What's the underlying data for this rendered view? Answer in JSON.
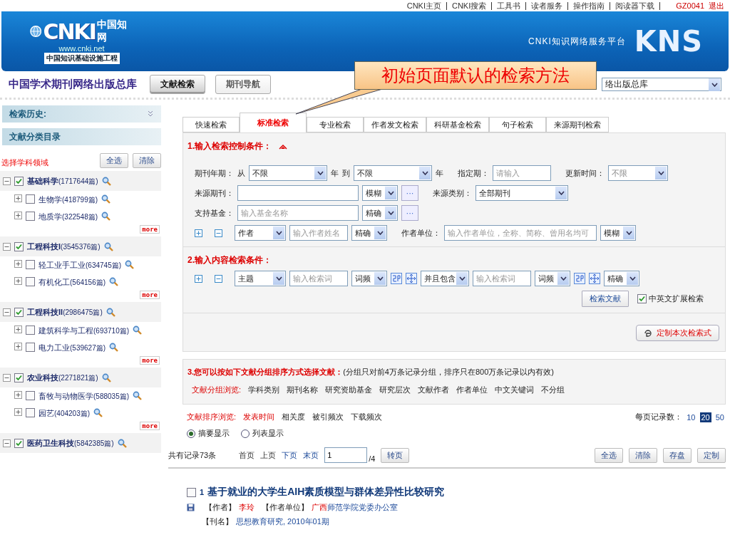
{
  "top_links": [
    "CNKI主页",
    "CNKI搜索",
    "工具书",
    "读者服务",
    "操作指南",
    "阅读器下载"
  ],
  "user": {
    "name": "GZ0041",
    "logout": "退出"
  },
  "header": {
    "logo_mark": "CNKI",
    "logo_calligraphy": "中国知网",
    "logo_url": "www.cnki.net",
    "logo_tagline": "中国知识基础设施工程",
    "platform": "CNKI知识网络服务平台",
    "brand": "KNS"
  },
  "subheader": {
    "title": "中国学术期刊网络出版总库",
    "tabs": [
      {
        "label": "文献检索",
        "selected": true
      },
      {
        "label": "期刊导航",
        "selected": false
      }
    ],
    "database_select": "络出版总库"
  },
  "callout": "初始页面默认的检索方法",
  "sidebar": {
    "history": "检索历史:",
    "catalog": "文献分类目录",
    "select_label": "选择学科领域",
    "buttons": [
      "全选",
      "清除"
    ],
    "categories": [
      {
        "name": "基础科学",
        "count": "(1717644篇)",
        "checked": true,
        "expanded": true,
        "children": [
          {
            "name": "生物学",
            "count": "(418799篇)",
            "checked": false
          },
          {
            "name": "地质学",
            "count": "(322548篇)",
            "checked": false
          }
        ],
        "more": "more"
      },
      {
        "name": "工程科技I",
        "count": "(3545376篇)",
        "checked": true,
        "expanded": true,
        "children": [
          {
            "name": "轻工业手工业",
            "count": "(634745篇)",
            "checked": false
          },
          {
            "name": "有机化工",
            "count": "(564156篇)",
            "checked": false
          }
        ],
        "more": "more"
      },
      {
        "name": "工程科技II",
        "count": "(2986475篇)",
        "checked": true,
        "expanded": true,
        "children": [
          {
            "name": "建筑科学与工程",
            "count": "(693710篇)",
            "checked": false
          },
          {
            "name": "电力工业",
            "count": "(539627篇)",
            "checked": false
          }
        ],
        "more": "more"
      },
      {
        "name": "农业科技",
        "count": "(2271821篇)",
        "checked": true,
        "expanded": true,
        "children": [
          {
            "name": "畜牧与动物医学",
            "count": "(588035篇)",
            "checked": false
          },
          {
            "name": "园艺",
            "count": "(404203篇)",
            "checked": false
          }
        ],
        "more": "more"
      },
      {
        "name": "医药卫生科技",
        "count": "(5842385篇)",
        "checked": true,
        "expanded": true
      }
    ]
  },
  "search_tabs": [
    {
      "label": "快速检索",
      "selected": false
    },
    {
      "label": "标准检索",
      "selected": true
    },
    {
      "label": "专业检索",
      "selected": false
    },
    {
      "label": "作者发文检索",
      "selected": false
    },
    {
      "label": "科研基金检索",
      "selected": false
    },
    {
      "label": "句子检索",
      "selected": false
    },
    {
      "label": "来源期刊检索",
      "selected": false
    }
  ],
  "section1": {
    "title": "1.输入检索控制条件：",
    "rows": [
      {
        "fields": [
          {
            "kind": "label",
            "text": "期刊年期："
          },
          {
            "kind": "label",
            "text": "从"
          },
          {
            "kind": "range_select",
            "text": "不限"
          },
          {
            "kind": "label",
            "text": "年"
          },
          {
            "kind": "label",
            "text": "到"
          },
          {
            "kind": "range_select",
            "text": "不限"
          },
          {
            "kind": "label",
            "text": "年"
          },
          {
            "kind": "gap"
          },
          {
            "kind": "label",
            "text": "指定期："
          },
          {
            "kind": "short_input",
            "placeholder": "请输入"
          },
          {
            "kind": "gap"
          },
          {
            "kind": "label",
            "text": "更新时间："
          },
          {
            "kind": "dim_select",
            "text": "不限"
          }
        ]
      },
      {
        "fields": [
          {
            "kind": "label",
            "text": "来源期刊："
          },
          {
            "kind": "wide_input"
          },
          {
            "kind": "match_select",
            "text": "模糊"
          },
          {
            "kind": "dots",
            "text": "···"
          },
          {
            "kind": "gap"
          },
          {
            "kind": "label",
            "text": "来源类别："
          },
          {
            "kind": "source_select",
            "text": "全部期刊"
          }
        ]
      },
      {
        "fields": [
          {
            "kind": "label",
            "text": "支持基金："
          },
          {
            "kind": "wide_input",
            "placeholder": "输入基金名称"
          },
          {
            "kind": "match_select",
            "text": "精确"
          },
          {
            "kind": "dots",
            "text": "···"
          }
        ]
      },
      {
        "fields": [
          {
            "kind": "plus"
          },
          {
            "kind": "minus"
          },
          {
            "kind": "field_select",
            "text": "作者"
          },
          {
            "kind": "short_input",
            "placeholder": "输入作者姓名"
          },
          {
            "kind": "match_select",
            "text": "精确"
          },
          {
            "kind": "gap"
          },
          {
            "kind": "label",
            "text": "作者单位："
          },
          {
            "kind": "long_input",
            "placeholder": "输入作者单位，全称、简称、曾用名均可"
          },
          {
            "kind": "match_select",
            "text": "模糊"
          }
        ]
      }
    ]
  },
  "section2": {
    "title": "2.输入内容检索条件：",
    "rows": [
      {
        "fields": [
          {
            "kind": "plus"
          },
          {
            "kind": "minus"
          },
          {
            "kind": "field_select",
            "text": "主题"
          },
          {
            "kind": "short_input",
            "placeholder": "输入检索词"
          },
          {
            "kind": "match_select",
            "text": "词频"
          },
          {
            "kind": "freq_icons"
          },
          {
            "kind": "logic_select",
            "text": "并且包含"
          },
          {
            "kind": "short_input",
            "placeholder": "输入检索词"
          },
          {
            "kind": "match_select",
            "text": "词频"
          },
          {
            "kind": "freq_icons"
          },
          {
            "kind": "match_select",
            "text": "精确"
          }
        ]
      }
    ],
    "search_button": "检索文献",
    "extend": {
      "label": "中英文扩展检索",
      "checked": true
    },
    "customize_button": "定制本次检索式"
  },
  "section3": {
    "title": "3.您可以按如下文献分组排序方式选择文献：",
    "note": "(分组只对前4万条记录分组，排序只在800万条记录以内有效)",
    "group_label": "文献分组浏览:",
    "groups": [
      "学科类别",
      "期刊名称",
      "研究资助基金",
      "研究层次",
      "文献作者",
      "作者单位",
      "中文关键词",
      "不分组"
    ]
  },
  "sorting": {
    "label": "文献排序浏览:",
    "options": [
      {
        "label": "发表时间",
        "selected": true
      },
      {
        "label": "相关度",
        "selected": false
      },
      {
        "label": "被引频次",
        "selected": false
      },
      {
        "label": "下载频次",
        "selected": false
      }
    ],
    "per_page_label": "每页记录数：",
    "per_page": [
      {
        "label": "10",
        "selected": false
      },
      {
        "label": "20",
        "selected": true
      },
      {
        "label": "50",
        "selected": false
      }
    ]
  },
  "display": [
    {
      "label": "摘要显示",
      "selected": true
    },
    {
      "label": "列表显示",
      "selected": false
    }
  ],
  "pager": {
    "total": "共有记录73条",
    "links": [
      {
        "label": "首页",
        "disabled": true
      },
      {
        "label": "上页",
        "disabled": true
      },
      {
        "label": "下页",
        "disabled": false
      },
      {
        "label": "末页",
        "disabled": false
      }
    ],
    "page": "1",
    "pages": "/4",
    "go": "转页",
    "buttons": [
      "全选",
      "清除",
      "存盘",
      "定制"
    ]
  },
  "results": [
    {
      "checked": false,
      "number": "1",
      "title": "基于就业的大学生AIH素质模型与群体差异性比较研究",
      "author_label": "【作者】",
      "author": "李玲",
      "unit_label": "【作者单位】",
      "unit_match": "广西",
      "unit_rest": "师范学院党委办公室",
      "journal_label": "【刊名】",
      "journal": "思想教育研究, 2010年01期"
    }
  ]
}
